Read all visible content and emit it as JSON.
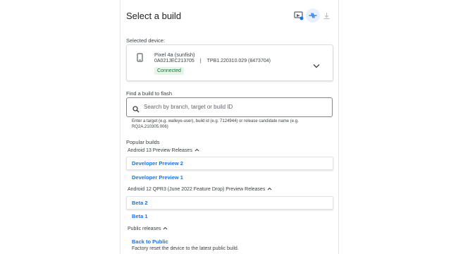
{
  "header": {
    "title": "Select a build",
    "icons": [
      "device-screenshot-icon",
      "connection-active-icon",
      "download-icon"
    ]
  },
  "device": {
    "section_label": "Selected device:",
    "name": "Pixel 4a (sunfish)",
    "serial": "0A021JEC213705",
    "separator": "|",
    "build": "TPB1.220310.029 (8473704)",
    "status": "Connected"
  },
  "search": {
    "section_label": "Find a build to flash",
    "placeholder": "Search by branch, target or build ID",
    "value": "",
    "hint": "Enter a target (e.g. walleye-user), build id (e.g. 7124944) or release candidate name (e.g. RQ2A.210305.006)"
  },
  "popular": {
    "section_label": "Popular builds",
    "groups": [
      {
        "title": "Android 13 Preview Releases",
        "items": [
          "Developer Preview 2",
          "Developer Preview 1"
        ]
      },
      {
        "title": "Android 12 QPR3 (June 2022 Feature Drop) Preview Releases",
        "items": [
          "Beta 2",
          "Beta 1"
        ]
      },
      {
        "title": "Public releases",
        "items": [
          "Back to Public"
        ],
        "item_desc": "Factory reset the device to the latest public build."
      }
    ]
  },
  "colors": {
    "accent": "#1a73e8",
    "connected_text": "#137333",
    "connected_bg": "#e6f4ea"
  }
}
